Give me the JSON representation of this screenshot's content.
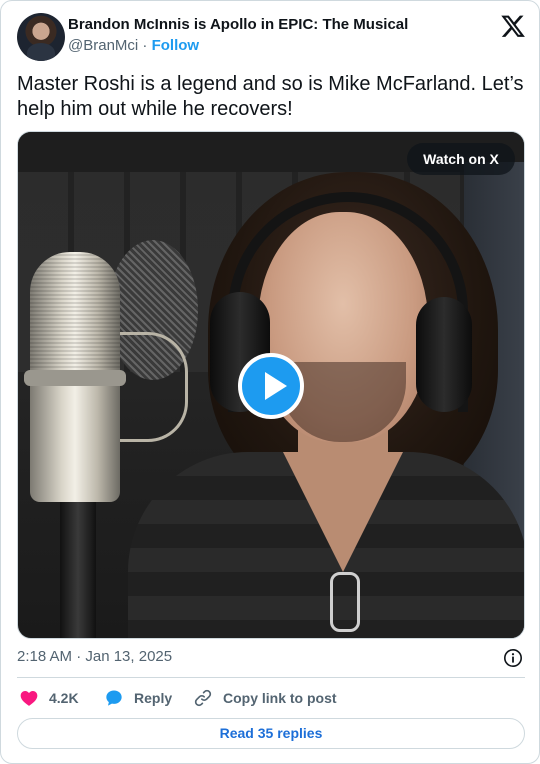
{
  "author": {
    "display_name": "Brandon McInnis is Apollo in EPIC: The Musical",
    "handle": "@BranMci",
    "separator": "·",
    "follow_label": "Follow"
  },
  "tweet": {
    "text": "Master Roshi is a legend and so is Mike McFarland. Let’s help him out while he recovers!",
    "timestamp": "2:18 AM · Jan 13, 2025"
  },
  "media": {
    "watch_label": "Watch on X",
    "play_icon": "play-icon"
  },
  "actions": {
    "likes": "4.2K",
    "reply_label": "Reply",
    "copy_label": "Copy link to post"
  },
  "read_replies_label": "Read 35 replies",
  "colors": {
    "accent": "#1d9bf0",
    "like": "#f91880",
    "link": "#1d6fd8",
    "muted": "#536471",
    "border": "#cfd9de"
  },
  "icons": [
    "x-logo-icon",
    "play-icon",
    "info-icon",
    "heart-icon",
    "reply-bubble-icon",
    "link-icon"
  ]
}
